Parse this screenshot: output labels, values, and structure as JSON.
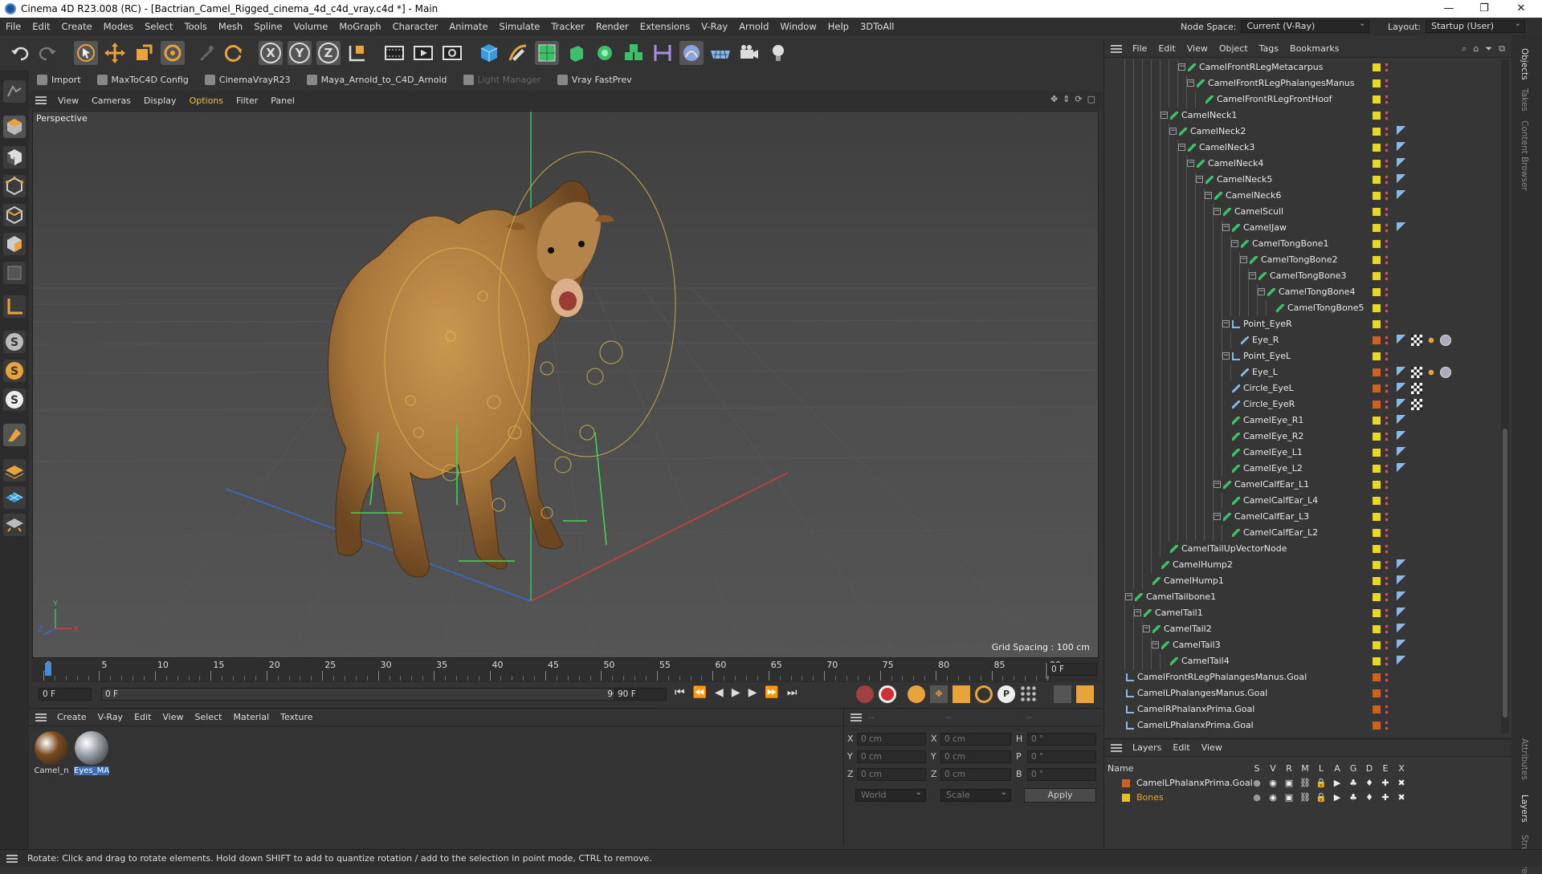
{
  "window": {
    "title": "Cinema 4D R23.008 (RC) - [Bactrian_Camel_Rigged_cinema_4d_c4d_vray.c4d *] - Main",
    "controls": [
      "—",
      "❐",
      "✕"
    ]
  },
  "menubar": {
    "items": [
      "File",
      "Edit",
      "Create",
      "Modes",
      "Select",
      "Tools",
      "Mesh",
      "Spline",
      "Volume",
      "MoGraph",
      "Character",
      "Animate",
      "Simulate",
      "Tracker",
      "Render",
      "Extensions",
      "V-Ray",
      "Arnold",
      "Window",
      "Help",
      "3DToAll"
    ],
    "node_space_label": "Node Space:",
    "node_space_value": "Current (V-Ray)",
    "layout_label": "Layout:",
    "layout_value": "Startup (User)"
  },
  "toolbar": {
    "icons": [
      "undo-icon",
      "redo-icon",
      "live-select-icon",
      "move-icon",
      "scale-icon",
      "rotate-icon",
      "recent-tool-icon",
      "rotate-tool-icon",
      "x-axis-icon",
      "y-axis-icon",
      "z-axis-icon",
      "world-coordinates-icon",
      "render-region-icon",
      "render-view-icon",
      "render-settings-icon",
      "cube-icon",
      "pen-icon",
      "subdivision-icon",
      "extrude-icon",
      "cloner-icon",
      "mograph-icon",
      "deformer-icon",
      "field-icon",
      "floor-icon",
      "camera-icon",
      "light-icon"
    ],
    "axis_labels": [
      "X",
      "Y",
      "Z"
    ]
  },
  "pluginbar": {
    "items": [
      {
        "label": "Import",
        "enabled": true
      },
      {
        "label": "MaxToC4D Config",
        "enabled": true
      },
      {
        "label": "CinemaVrayR23",
        "enabled": true
      },
      {
        "label": "Maya_Arnold_to_C4D_Arnold",
        "enabled": true
      },
      {
        "label": "Light Manager",
        "enabled": false
      },
      {
        "label": "Vray FastPrev",
        "enabled": true
      }
    ]
  },
  "viewport": {
    "menu": [
      "View",
      "Cameras",
      "Display",
      "Options",
      "Filter",
      "Panel"
    ],
    "active_menu": "Options",
    "label": "Perspective",
    "grid_spacing": "Grid Spacing : 100 cm",
    "axis_labels": {
      "x": "X",
      "y": "Y",
      "z": "Z"
    }
  },
  "timeline": {
    "ticks": [
      "0",
      "5",
      "10",
      "15",
      "20",
      "25",
      "30",
      "35",
      "40",
      "45",
      "50",
      "55",
      "60",
      "65",
      "70",
      "75",
      "80",
      "85",
      "90"
    ],
    "current_frame_display": "0 F",
    "start_field": "0 F",
    "preview_start": "0 F",
    "preview_end": "90 F",
    "end_field": "90 F"
  },
  "materials": {
    "menu": [
      "Create",
      "V-Ray",
      "Edit",
      "View",
      "Select",
      "Material",
      "Texture"
    ],
    "items": [
      {
        "label": "Camel_n",
        "selected": false,
        "color": "#7a4a1c"
      },
      {
        "label": "Eyes_MA",
        "selected": true,
        "color": "#9aa0a8"
      }
    ]
  },
  "coordinates": {
    "header_dashes": [
      "--",
      "--",
      "--"
    ],
    "rows": [
      {
        "a": "X",
        "av": "0 cm",
        "b": "X",
        "bv": "0 cm",
        "c": "H",
        "cv": "0 °"
      },
      {
        "a": "Y",
        "av": "0 cm",
        "b": "Y",
        "bv": "0 cm",
        "c": "P",
        "cv": "0 °"
      },
      {
        "a": "Z",
        "av": "0 cm",
        "b": "Z",
        "bv": "0 cm",
        "c": "B",
        "cv": "0 °"
      }
    ],
    "mode": "World",
    "transform": "Scale",
    "apply": "Apply"
  },
  "objects": {
    "menu": [
      "File",
      "Edit",
      "View",
      "Object",
      "Tags",
      "Bookmarks"
    ],
    "rows": [
      {
        "label": "CamelFrontRLegMetacarpus",
        "depth": 8,
        "exp": true,
        "color": "#e8d820",
        "tags": 0
      },
      {
        "label": "CamelFrontRLegPhalangesManus",
        "depth": 9,
        "exp": true,
        "color": "#e8d820",
        "tags": 0
      },
      {
        "label": "CamelFrontRLegFrontHoof",
        "depth": 10,
        "exp": false,
        "color": "#e8d820",
        "tags": 0
      },
      {
        "label": "CamelNeck1",
        "depth": 6,
        "exp": true,
        "color": "#e8d820",
        "tags": 0
      },
      {
        "label": "CamelNeck2",
        "depth": 7,
        "exp": true,
        "color": "#e8d820",
        "tags": 1
      },
      {
        "label": "CamelNeck3",
        "depth": 8,
        "exp": true,
        "color": "#e8d820",
        "tags": 1
      },
      {
        "label": "CamelNeck4",
        "depth": 9,
        "exp": true,
        "color": "#e8d820",
        "tags": 1
      },
      {
        "label": "CamelNeck5",
        "depth": 10,
        "exp": true,
        "color": "#e8d820",
        "tags": 1
      },
      {
        "label": "CamelNeck6",
        "depth": 11,
        "exp": true,
        "color": "#e8d820",
        "tags": 1
      },
      {
        "label": "CamelScull",
        "depth": 12,
        "exp": true,
        "color": "#e8d820",
        "tags": 0
      },
      {
        "label": "CamelJaw",
        "depth": 13,
        "exp": true,
        "color": "#e8d820",
        "tags": 1
      },
      {
        "label": "CamelTongBone1",
        "depth": 14,
        "exp": true,
        "color": "#e8d820",
        "tags": 0
      },
      {
        "label": "CamelTongBone2",
        "depth": 15,
        "exp": true,
        "color": "#e8d820",
        "tags": 0
      },
      {
        "label": "CamelTongBone3",
        "depth": 16,
        "exp": true,
        "color": "#e8d820",
        "tags": 0
      },
      {
        "label": "CamelTongBone4",
        "depth": 17,
        "exp": true,
        "color": "#e8d820",
        "tags": 0
      },
      {
        "label": "CamelTongBone5",
        "depth": 18,
        "exp": false,
        "color": "#e8d820",
        "tags": 0
      },
      {
        "label": "Point_EyeR",
        "depth": 13,
        "exp": true,
        "color": "#e8d820",
        "tags": 0,
        "null": true
      },
      {
        "label": "Eye_R",
        "depth": 14,
        "exp": false,
        "color": "#d06020",
        "tags": 4,
        "mesh": true
      },
      {
        "label": "Point_EyeL",
        "depth": 13,
        "exp": true,
        "color": "#e8d820",
        "tags": 0,
        "null": true
      },
      {
        "label": "Eye_L",
        "depth": 14,
        "exp": false,
        "color": "#d06020",
        "tags": 4,
        "mesh": true
      },
      {
        "label": "Circle_EyeL",
        "depth": 13,
        "exp": false,
        "color": "#d06020",
        "tags": 2,
        "mesh": true
      },
      {
        "label": "Circle_EyeR",
        "depth": 13,
        "exp": false,
        "color": "#d06020",
        "tags": 2,
        "mesh": true
      },
      {
        "label": "CamelEye_R1",
        "depth": 13,
        "exp": false,
        "color": "#e8d820",
        "tags": 1
      },
      {
        "label": "CamelEye_R2",
        "depth": 13,
        "exp": false,
        "color": "#e8d820",
        "tags": 1
      },
      {
        "label": "CamelEye_L1",
        "depth": 13,
        "exp": false,
        "color": "#e8d820",
        "tags": 1
      },
      {
        "label": "CamelEye_L2",
        "depth": 13,
        "exp": false,
        "color": "#e8d820",
        "tags": 1
      },
      {
        "label": "CamelCalfEar_L1",
        "depth": 12,
        "exp": true,
        "color": "#e8d820",
        "tags": 0
      },
      {
        "label": "CamelCalfEar_L4",
        "depth": 13,
        "exp": false,
        "color": "#e8d820",
        "tags": 0
      },
      {
        "label": "CamelCalfEar_L3",
        "depth": 12,
        "exp": true,
        "color": "#e8d820",
        "tags": 0
      },
      {
        "label": "CamelCalfEar_L2",
        "depth": 13,
        "exp": false,
        "color": "#e8d820",
        "tags": 0
      },
      {
        "label": "CamelTailUpVectorNode",
        "depth": 6,
        "exp": false,
        "color": "#e8d820",
        "tags": 0
      },
      {
        "label": "CamelHump2",
        "depth": 5,
        "exp": false,
        "color": "#e8d820",
        "tags": 1
      },
      {
        "label": "CamelHump1",
        "depth": 4,
        "exp": false,
        "color": "#e8d820",
        "tags": 1
      },
      {
        "label": "CamelTailbone1",
        "depth": 2,
        "exp": true,
        "color": "#e8d820",
        "tags": 1
      },
      {
        "label": "CamelTail1",
        "depth": 3,
        "exp": true,
        "color": "#e8d820",
        "tags": 1
      },
      {
        "label": "CamelTail2",
        "depth": 4,
        "exp": true,
        "color": "#e8d820",
        "tags": 1
      },
      {
        "label": "CamelTail3",
        "depth": 5,
        "exp": true,
        "color": "#e8d820",
        "tags": 1
      },
      {
        "label": "CamelTail4",
        "depth": 6,
        "exp": false,
        "color": "#e8d820",
        "tags": 1
      },
      {
        "label": "CamelFrontRLegPhalangesManus.Goal",
        "depth": 1,
        "exp": false,
        "color": "#d06020",
        "tags": 0,
        "null": true
      },
      {
        "label": "CamelLPhalangesManus.Goal",
        "depth": 1,
        "exp": false,
        "color": "#d06020",
        "tags": 0,
        "null": true
      },
      {
        "label": "CamelRPhalanxPrima.Goal",
        "depth": 1,
        "exp": false,
        "color": "#d06020",
        "tags": 0,
        "null": true
      },
      {
        "label": "CamelLPhalanxPrima.Goal",
        "depth": 1,
        "exp": false,
        "color": "#d06020",
        "tags": 0,
        "null": true
      }
    ]
  },
  "layers": {
    "menu": [
      "Layers",
      "Edit",
      "View"
    ],
    "name_header": "Name",
    "columns": [
      "S",
      "V",
      "R",
      "M",
      "L",
      "A",
      "G",
      "D",
      "E",
      "X"
    ],
    "rows": [
      {
        "label": "CamelLPhalanxPrima.Goal",
        "color": "#d06020",
        "text_color": "#e8e8e8"
      },
      {
        "label": "Bones",
        "color": "#e8c020",
        "text_color": "#f0a030"
      }
    ]
  },
  "right_tabs": [
    "Objects",
    "Takes",
    "Content Browser",
    "Attributes",
    "Layers",
    "Structure"
  ],
  "status": {
    "text": "Rotate: Click and drag to rotate elements. Hold down SHIFT to add to quantize rotation / add to the selection in point mode, CTRL to remove."
  }
}
